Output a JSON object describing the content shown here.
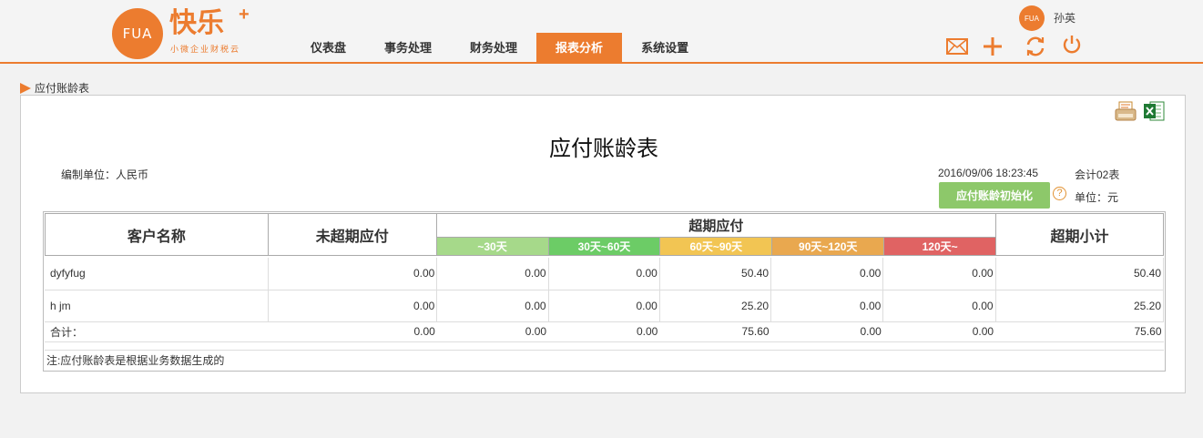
{
  "brand": {
    "logo_text": "FUA",
    "name": "快乐",
    "plus": "+",
    "slogan": "小微企业财税云"
  },
  "nav": [
    {
      "label": "仪表盘",
      "active": false
    },
    {
      "label": "事务处理",
      "active": false
    },
    {
      "label": "财务处理",
      "active": false
    },
    {
      "label": "报表分析",
      "active": true
    },
    {
      "label": "系统设置",
      "active": false
    }
  ],
  "user": {
    "avatar_text": "FUA",
    "name": "孙英"
  },
  "toolbar_icons": [
    "mail-icon",
    "plus-icon",
    "refresh-icon",
    "power-icon"
  ],
  "breadcrumb": "应付账龄表",
  "report": {
    "title": "应付账龄表",
    "unit_left": "编制单位：人民币",
    "date": "2016/09/06 18:23:45",
    "count": "会计02表",
    "init_button": "应付账龄初始化",
    "help": "?",
    "unit_right": "单位：元",
    "export_icons": [
      "print-icon",
      "excel-icon"
    ]
  },
  "table": {
    "col_customer": "客户名称",
    "col_not_overdue": "未超期应付",
    "col_overdue": "超期应付",
    "col_subtotal": "超期小计",
    "buckets": [
      {
        "label": "~30天",
        "color": "#a6d98a"
      },
      {
        "label": "30天~60天",
        "color": "#6ccc66"
      },
      {
        "label": "60天~90天",
        "color": "#f2c553"
      },
      {
        "label": "90天~120天",
        "color": "#e9a84f"
      },
      {
        "label": "120天~",
        "color": "#e06363"
      }
    ],
    "rows": [
      {
        "name": "dyfyfug",
        "values": [
          "0.00",
          "0.00",
          "0.00",
          "50.40",
          "0.00",
          "0.00",
          "50.40"
        ]
      },
      {
        "name": "h jm",
        "values": [
          "0.00",
          "0.00",
          "0.00",
          "25.20",
          "0.00",
          "0.00",
          "25.20"
        ]
      }
    ],
    "total": {
      "label": "合计：",
      "values": [
        "0.00",
        "0.00",
        "0.00",
        "75.60",
        "0.00",
        "0.00",
        "75.60"
      ]
    },
    "note": "注:应付账龄表是根据业务数据生成的"
  }
}
